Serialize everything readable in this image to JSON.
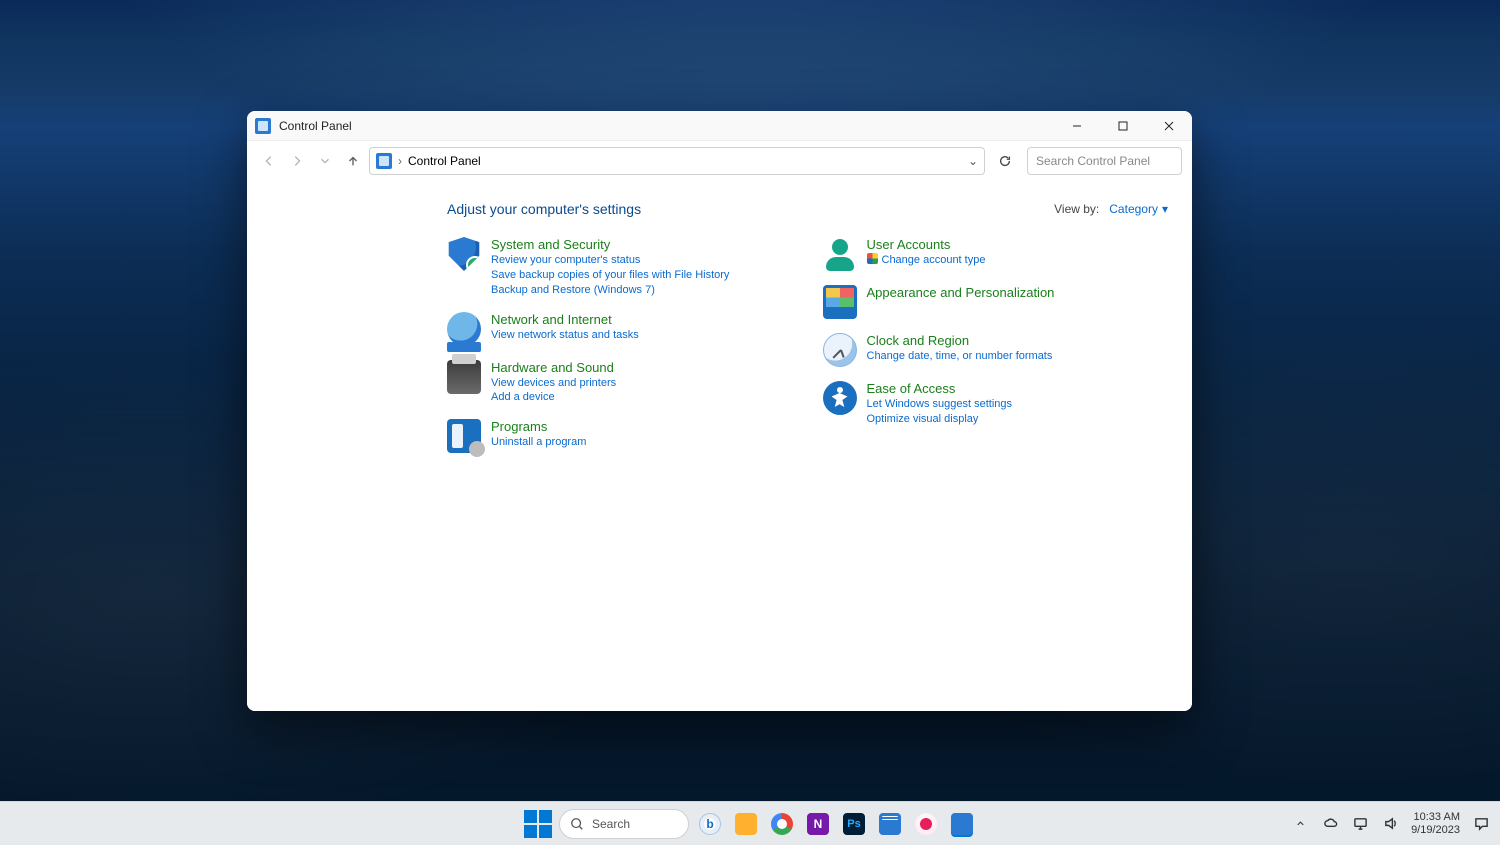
{
  "window": {
    "title": "Control Panel",
    "breadcrumb": "Control Panel",
    "search_placeholder": "Search Control Panel"
  },
  "header": {
    "title": "Adjust your computer's settings",
    "viewby_label": "View by:",
    "viewby_value": "Category"
  },
  "categories_left": [
    {
      "icon": "shield",
      "title": "System and Security",
      "links": [
        "Review your computer's status",
        "Save backup copies of your files with File History",
        "Backup and Restore (Windows 7)"
      ]
    },
    {
      "icon": "globe",
      "title": "Network and Internet",
      "links": [
        "View network status and tasks"
      ]
    },
    {
      "icon": "printer",
      "title": "Hardware and Sound",
      "links": [
        "View devices and printers",
        "Add a device"
      ]
    },
    {
      "icon": "programs",
      "title": "Programs",
      "links": [
        "Uninstall a program"
      ]
    }
  ],
  "categories_right": [
    {
      "icon": "user",
      "title": "User Accounts",
      "links": [
        "Change account type"
      ],
      "shield_on_first": true
    },
    {
      "icon": "appear",
      "title": "Appearance and Personalization",
      "links": []
    },
    {
      "icon": "clock",
      "title": "Clock and Region",
      "links": [
        "Change date, time, or number formats"
      ]
    },
    {
      "icon": "ease",
      "title": "Ease of Access",
      "links": [
        "Let Windows suggest settings",
        "Optimize visual display"
      ]
    }
  ],
  "taskbar": {
    "search_label": "Search",
    "time": "10:33 AM",
    "date": "9/19/2023"
  }
}
